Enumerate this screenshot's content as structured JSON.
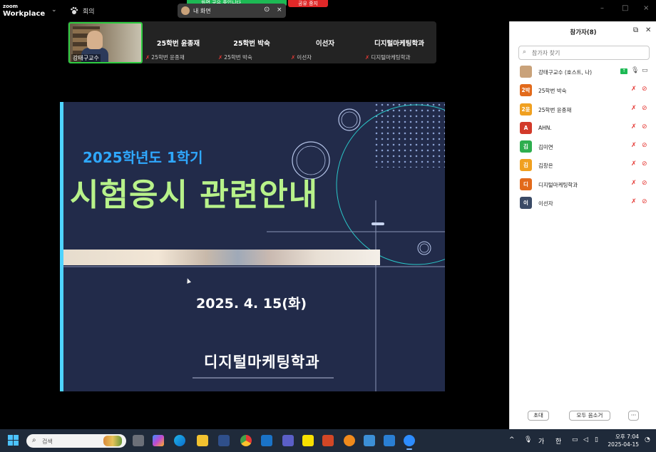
{
  "app": {
    "logo_line1": "zoom",
    "logo_line2": "Workplace",
    "meeting_label": "회의"
  },
  "share_bar": {
    "status": "화면 공유 중입니다",
    "stop_label": "공유 중지",
    "pill_label": "내 화면"
  },
  "video_strip": {
    "self_name": "강태구교수",
    "tiles": [
      {
        "big": "25학번 윤종재",
        "small": "25학번 윤종재"
      },
      {
        "big": "25학번 박숙",
        "small": "25학번 박숙"
      },
      {
        "big": "이선자",
        "small": "이선자"
      },
      {
        "big": "디지털마케팅학과",
        "small": "디지털마케팅학과"
      }
    ]
  },
  "slide": {
    "year_line": "2025학년도 1학기",
    "main_title": "시험응시 관련안내",
    "date": "2025. 4. 15(화)",
    "department": "디지털마케팅학과"
  },
  "participants": {
    "title": "참가자(8)",
    "search_placeholder": "참가자 찾기",
    "items": [
      {
        "avatar": "",
        "name": "강태구교수 (호스트, 나)",
        "color": "#c9a27a"
      },
      {
        "avatar": "2박",
        "name": "25학번 박숙",
        "color": "#e26a1b"
      },
      {
        "avatar": "2윤",
        "name": "25학번 윤종재",
        "color": "#f0a020"
      },
      {
        "avatar": "A",
        "name": "AHN.",
        "color": "#d23a2a"
      },
      {
        "avatar": "김",
        "name": "김미연",
        "color": "#2eae4e"
      },
      {
        "avatar": "김",
        "name": "김창은",
        "color": "#f0a020"
      },
      {
        "avatar": "디",
        "name": "디지털마케팅학과",
        "color": "#e26a1b"
      },
      {
        "avatar": "이",
        "name": "이선자",
        "color": "#3a4a66"
      }
    ],
    "invite_label": "초대",
    "mute_all_label": "모두 음소거",
    "more_label": "···"
  },
  "taskbar": {
    "search_label": "검색",
    "ime_1": "가",
    "ime_2": "한",
    "time": "오후 7:04",
    "date": "2025-04-15"
  }
}
